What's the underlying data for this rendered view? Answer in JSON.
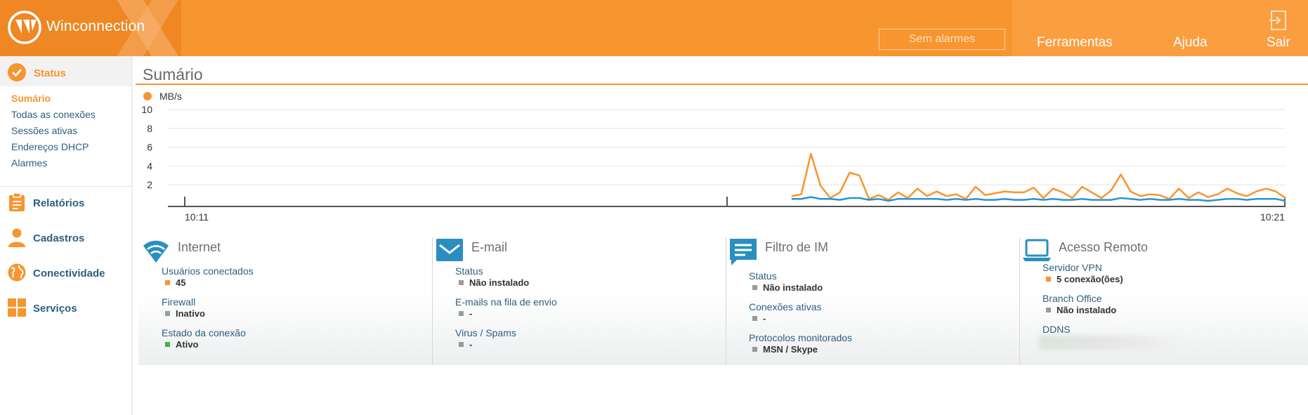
{
  "header": {
    "brand": "Winconnection",
    "alarm_label": "Sem alarmes",
    "nav": [
      "Ferramentas",
      "Ajuda",
      "Sair"
    ]
  },
  "sidebar": {
    "status_label": "Status",
    "sub_items": [
      {
        "label": "Sumário",
        "active": true
      },
      {
        "label": "Todas as conexões",
        "active": false
      },
      {
        "label": "Sessões ativas",
        "active": false
      },
      {
        "label": "Endereços DHCP",
        "active": false
      },
      {
        "label": "Alarmes",
        "active": false
      }
    ],
    "main_items": [
      {
        "label": "Relatórios",
        "icon": "clipboard-icon"
      },
      {
        "label": "Cadastros",
        "icon": "user-icon"
      },
      {
        "label": "Conectividade",
        "icon": "globe-icon"
      },
      {
        "label": "Serviços",
        "icon": "grid-icon"
      }
    ]
  },
  "main": {
    "title": "Sumário"
  },
  "chart_data": {
    "type": "line",
    "legend": "MB/s",
    "y_ticks": [
      10,
      8,
      6,
      4,
      2
    ],
    "ylim": [
      0,
      10
    ],
    "x_tick_labels": [
      "10:11",
      "10:21"
    ],
    "colors": {
      "orange": "#f7952f",
      "blue": "#2a93d5"
    },
    "series_start_fraction": 0.558,
    "series": [
      {
        "color": "#f7952f",
        "values": [
          0.8,
          1.0,
          5.3,
          1.9,
          0.6,
          1.2,
          3.3,
          3.0,
          0.5,
          0.9,
          0.4,
          1.2,
          0.6,
          1.6,
          0.8,
          1.3,
          0.8,
          1.0,
          0.5,
          1.8,
          0.9,
          1.1,
          1.3,
          1.2,
          1.2,
          1.7,
          0.6,
          1.6,
          1.2,
          0.6,
          1.8,
          1.2,
          0.6,
          1.4,
          3.1,
          1.3,
          0.8,
          1.0,
          0.9,
          0.5,
          1.6,
          0.6,
          1.2,
          0.7,
          1.0,
          1.6,
          1.1,
          0.8,
          1.3,
          1.6,
          1.3,
          0.6
        ]
      },
      {
        "color": "#2a93d5",
        "values": [
          0.5,
          0.5,
          0.7,
          0.5,
          0.5,
          0.4,
          0.6,
          0.6,
          0.4,
          0.5,
          0.3,
          0.5,
          0.5,
          0.5,
          0.5,
          0.5,
          0.4,
          0.5,
          0.4,
          0.5,
          0.4,
          0.4,
          0.5,
          0.4,
          0.4,
          0.5,
          0.4,
          0.5,
          0.4,
          0.4,
          0.5,
          0.4,
          0.4,
          0.4,
          0.6,
          0.5,
          0.4,
          0.5,
          0.4,
          0.4,
          0.5,
          0.4,
          0.4,
          0.3,
          0.4,
          0.5,
          0.5,
          0.4,
          0.5,
          0.5,
          0.5,
          0.3
        ]
      }
    ]
  },
  "panels": [
    {
      "title": "Internet",
      "icon": "wifi-icon",
      "fields": [
        {
          "label": "Usuários conectados",
          "value": "45",
          "bullet_color": "#f7952f"
        },
        {
          "label": "Firewall",
          "value": "Inativo",
          "bullet_color": "#9a9a9a"
        },
        {
          "label": "Estado da conexão",
          "value": "Ativo",
          "bullet_color": "#3bb54a"
        }
      ]
    },
    {
      "title": "E-mail",
      "icon": "envelope-icon",
      "fields": [
        {
          "label": "Status",
          "value": "Não instalado",
          "bullet_color": "#9a9a9a"
        },
        {
          "label": "E-mails na fila de envio",
          "value": "-",
          "bullet_color": "#9a9a9a"
        },
        {
          "label": "Virus / Spams",
          "value": "-",
          "bullet_color": "#9a9a9a"
        }
      ]
    },
    {
      "title": "Filtro de IM",
      "icon": "chat-icon",
      "fields": [
        {
          "label": "Status",
          "value": "Não instalado",
          "bullet_color": "#9a9a9a"
        },
        {
          "label": "Conexões ativas",
          "value": "-",
          "bullet_color": "#9a9a9a"
        },
        {
          "label": "Protocolos monitorados",
          "value": "MSN / Skype",
          "bullet_color": "#9a9a9a"
        }
      ]
    },
    {
      "title": "Acesso Remoto",
      "icon": "laptop-icon",
      "fields": [
        {
          "label": "Servidor VPN",
          "value": "5 conexão(ões)",
          "bullet_color": "#f7952f"
        },
        {
          "label": "Branch Office",
          "value": "Não instalado",
          "bullet_color": "#9a9a9a"
        },
        {
          "label": "DDNS",
          "value": "",
          "bullet_color": ""
        }
      ]
    }
  ]
}
